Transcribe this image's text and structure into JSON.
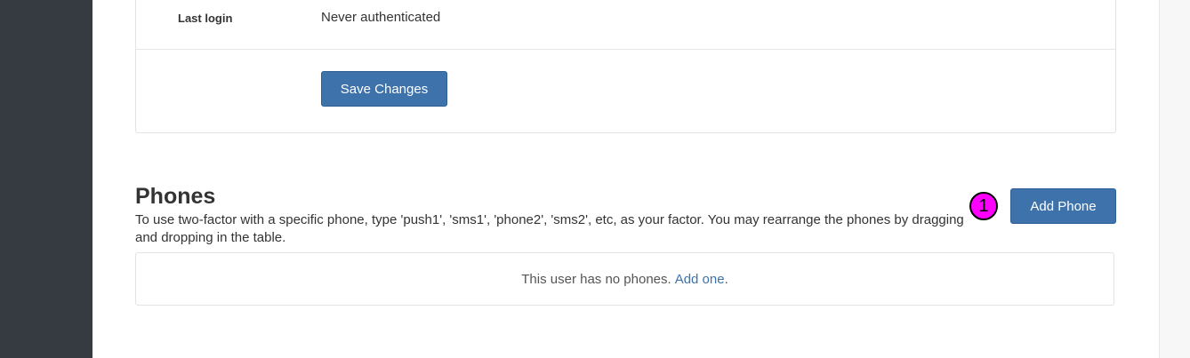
{
  "details": {
    "last_login_label": "Last login",
    "last_login_value": "Never authenticated",
    "save_label": "Save Changes"
  },
  "phones": {
    "title": "Phones",
    "description": "To use two-factor with a specific phone, type 'push1', 'sms1', 'phone2', 'sms2', etc, as your factor. You may rearrange the phones by dragging and dropping in the table.",
    "add_label": "Add Phone",
    "marker": "1",
    "empty_text": "This user has no phones.",
    "empty_link": "Add one",
    "empty_suffix": "."
  },
  "colors": {
    "sidebar": "#353b41",
    "primary_button": "#3d72ab",
    "marker": "#ff00ff"
  }
}
